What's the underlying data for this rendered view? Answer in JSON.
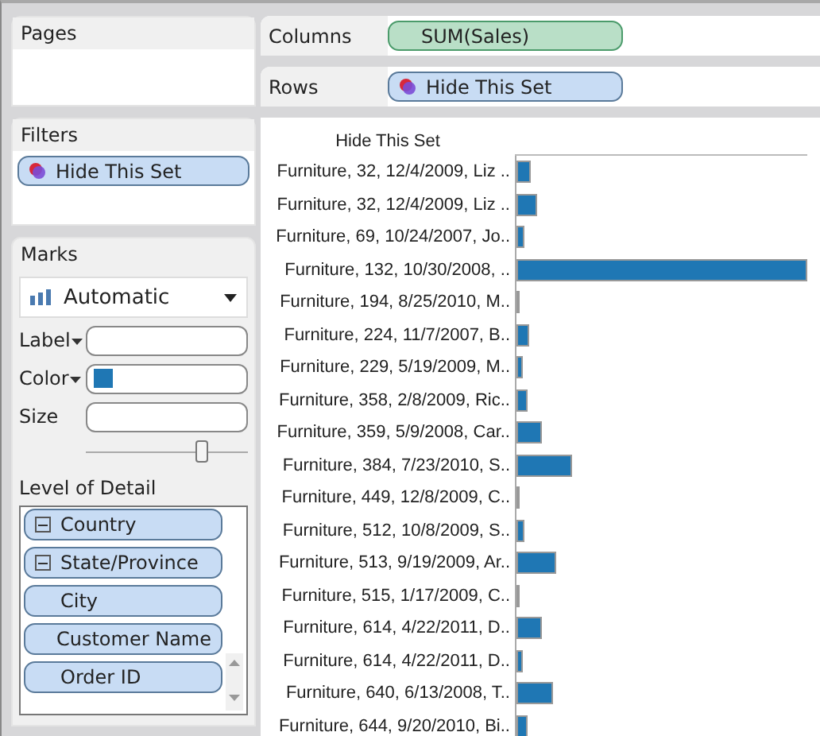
{
  "pages": {
    "title": "Pages"
  },
  "filters": {
    "title": "Filters",
    "pills": [
      {
        "label": "Hide This Set",
        "kind": "set"
      }
    ]
  },
  "marks": {
    "title": "Marks",
    "mark_type": "Automatic",
    "properties": [
      {
        "label": "Label",
        "kind": "dropdown"
      },
      {
        "label": "Color",
        "kind": "color",
        "color": "#1f77b4"
      },
      {
        "label": "Size",
        "kind": "plain"
      }
    ],
    "size_slider": {
      "level": 0.72
    },
    "detail": {
      "title": "Level of Detail",
      "pills": [
        {
          "label": "Country",
          "expanded": true
        },
        {
          "label": "State/Province",
          "expanded": true
        },
        {
          "label": "City",
          "expanded": false
        },
        {
          "label": "Customer Name",
          "expanded": false
        },
        {
          "label": "Order ID",
          "expanded": false
        }
      ]
    }
  },
  "columns": {
    "label": "Columns",
    "pill": "SUM(Sales)"
  },
  "rows": {
    "label": "Rows",
    "pill": "Hide This Set"
  },
  "view": {
    "header": "Hide This Set",
    "rows": [
      {
        "label": "Furniture, 32, 12/4/2009, Liz ..",
        "level": 0.05
      },
      {
        "label": "Furniture, 32, 12/4/2009, Liz ..",
        "level": 0.07
      },
      {
        "label": "Furniture, 69, 10/24/2007, Jo..",
        "level": 0.03
      },
      {
        "label": "Furniture, 132, 10/30/2008, ..",
        "level": 1.0
      },
      {
        "label": "Furniture, 194, 8/25/2010, M..",
        "level": 0.005
      },
      {
        "label": "Furniture, 224, 11/7/2007, B..",
        "level": 0.045
      },
      {
        "label": "Furniture, 229, 5/19/2009, M..",
        "level": 0.02
      },
      {
        "label": "Furniture, 358, 2/8/2009, Ric..",
        "level": 0.04
      },
      {
        "label": "Furniture, 359, 5/9/2008, Car..",
        "level": 0.09
      },
      {
        "label": "Furniture, 384, 7/23/2010, S..",
        "level": 0.19
      },
      {
        "label": "Furniture, 449, 12/8/2009, C..",
        "level": 0.01
      },
      {
        "label": "Furniture, 512, 10/8/2009, S..",
        "level": 0.03
      },
      {
        "label": "Furniture, 513, 9/19/2009, Ar..",
        "level": 0.135
      },
      {
        "label": "Furniture, 515, 1/17/2009, C..",
        "level": 0.005
      },
      {
        "label": "Furniture, 614, 4/22/2011, D..",
        "level": 0.085
      },
      {
        "label": "Furniture, 614, 4/22/2011, D..",
        "level": 0.02
      },
      {
        "label": "Furniture, 640, 6/13/2008, T..",
        "level": 0.125
      },
      {
        "label": "Furniture, 644, 9/20/2010, Bi..",
        "level": 0.04
      }
    ]
  }
}
